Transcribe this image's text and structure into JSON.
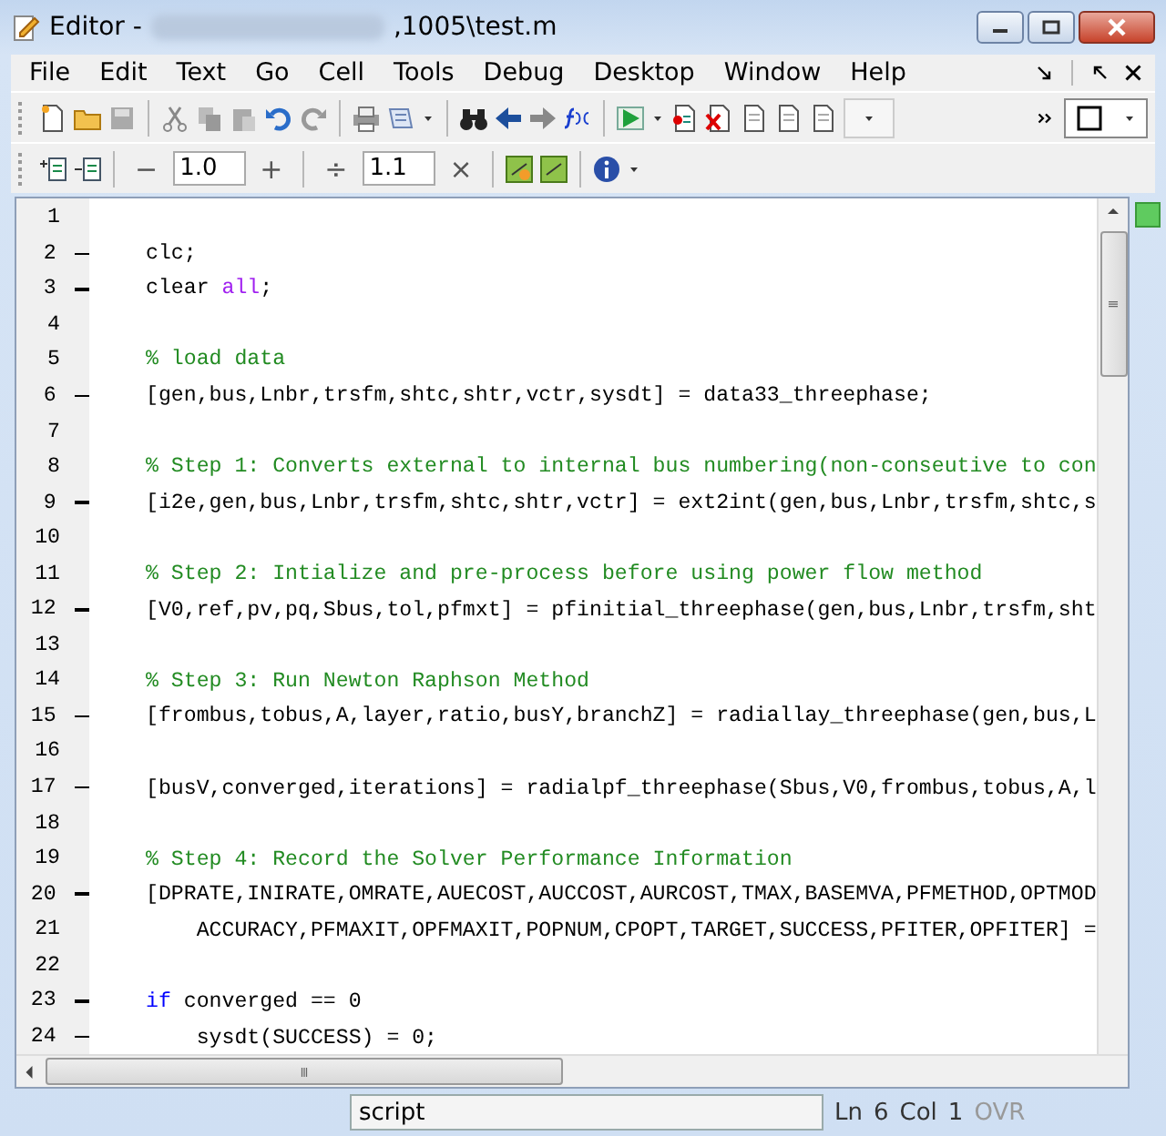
{
  "window": {
    "title_prefix": "Editor -",
    "title_suffix": ",1005\\test.m"
  },
  "menu": [
    "File",
    "Edit",
    "Text",
    "Go",
    "Cell",
    "Tools",
    "Debug",
    "Desktop",
    "Window",
    "Help"
  ],
  "cell_toolbar": {
    "minus": "−",
    "field_1": "1.0",
    "plus": "+",
    "divide": "÷",
    "field_2": "1.1",
    "times": "×"
  },
  "editor": {
    "lines": [
      {
        "number": "1",
        "executable": false
      },
      {
        "number": "2",
        "executable": true,
        "segments": [
          {
            "kind": "code",
            "text": "clc;"
          }
        ]
      },
      {
        "number": "3",
        "executable": true,
        "segments": [
          {
            "kind": "code",
            "text": "clear "
          },
          {
            "kind": "string",
            "text": "all"
          },
          {
            "kind": "code",
            "text": ";"
          }
        ]
      },
      {
        "number": "4",
        "executable": false
      },
      {
        "number": "5",
        "executable": false,
        "segments": [
          {
            "kind": "comment",
            "text": "% load data"
          }
        ]
      },
      {
        "number": "6",
        "executable": true,
        "segments": [
          {
            "kind": "code",
            "text": "[gen,bus,Lnbr,trsfm,shtc,shtr,vctr,sysdt] = data33_threephase;"
          }
        ]
      },
      {
        "number": "7",
        "executable": false
      },
      {
        "number": "8",
        "executable": false,
        "segments": [
          {
            "kind": "comment",
            "text": "% Step 1: Converts external to internal bus numbering(non-conseutive to con"
          }
        ]
      },
      {
        "number": "9",
        "executable": true,
        "segments": [
          {
            "kind": "code",
            "text": "[i2e,gen,bus,Lnbr,trsfm,shtc,shtr,vctr] = ext2int(gen,bus,Lnbr,trsfm,shtc,s"
          }
        ]
      },
      {
        "number": "10",
        "executable": false
      },
      {
        "number": "11",
        "executable": false,
        "segments": [
          {
            "kind": "comment",
            "text": "% Step 2: Intialize and pre-process before using power flow method"
          }
        ]
      },
      {
        "number": "12",
        "executable": true,
        "segments": [
          {
            "kind": "code",
            "text": "[V0,ref,pv,pq,Sbus,tol,pfmxt] = pfinitial_threephase(gen,bus,Lnbr,trsfm,sht"
          }
        ]
      },
      {
        "number": "13",
        "executable": false
      },
      {
        "number": "14",
        "executable": false,
        "segments": [
          {
            "kind": "comment",
            "text": "% Step 3: Run Newton Raphson Method"
          }
        ]
      },
      {
        "number": "15",
        "executable": true,
        "segments": [
          {
            "kind": "code",
            "text": "[frombus,tobus,A,layer,ratio,busY,branchZ] = radiallay_threephase(gen,bus,L"
          }
        ]
      },
      {
        "number": "16",
        "executable": false
      },
      {
        "number": "17",
        "executable": true,
        "segments": [
          {
            "kind": "code",
            "text": "[busV,converged,iterations] = radialpf_threephase(Sbus,V0,frombus,tobus,A,l"
          }
        ]
      },
      {
        "number": "18",
        "executable": false
      },
      {
        "number": "19",
        "executable": false,
        "segments": [
          {
            "kind": "comment",
            "text": "% Step 4: Record the Solver Performance Information"
          }
        ]
      },
      {
        "number": "20",
        "executable": true,
        "segments": [
          {
            "kind": "code",
            "text": "[DPRATE,INIRATE,OMRATE,AUECOST,AUCCOST,AURCOST,TMAX,BASEMVA,PFMETHOD,OPTMOD"
          }
        ]
      },
      {
        "number": "21",
        "executable": false,
        "segments": [
          {
            "kind": "code",
            "text": "    ACCURACY,PFMAXIT,OPFMAXIT,POPNUM,CPOPT,TARGET,SUCCESS,PFITER,OPFITER] ="
          }
        ]
      },
      {
        "number": "22",
        "executable": false
      },
      {
        "number": "23",
        "executable": true,
        "segments": [
          {
            "kind": "keyword",
            "text": "if"
          },
          {
            "kind": "code",
            "text": " converged == 0"
          }
        ]
      },
      {
        "number": "24",
        "executable": true,
        "segments": [
          {
            "kind": "code",
            "text": "    sysdt(SUCCESS) = 0;"
          }
        ]
      }
    ]
  },
  "status_bar": {
    "mode": "script",
    "ln_label": "Ln",
    "ln": "6",
    "col_label": "Col",
    "col": "1",
    "ovr": "OVR"
  }
}
